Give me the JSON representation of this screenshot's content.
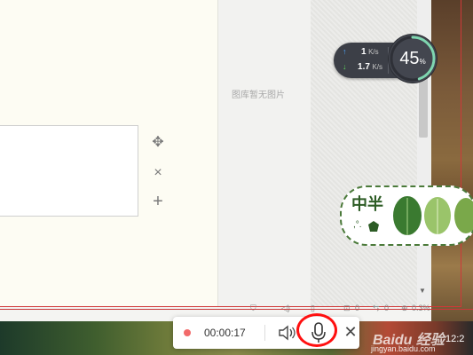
{
  "gallery": {
    "empty_text": "图库暂无图片"
  },
  "image_controls": {
    "move_symbol": "✥",
    "delete_symbol": "×",
    "add_symbol": "+"
  },
  "net_speed": {
    "upload_value": "1",
    "upload_unit": "K/s",
    "download_value": "1.7",
    "download_unit": "K/s",
    "usage_value": "45",
    "usage_unit": "%",
    "usage_fraction": 0.45,
    "up_arrow": "↑",
    "down_arrow": "↓"
  },
  "sticker": {
    "text": "中半",
    "sub": ",°."
  },
  "status_row": {
    "item3": "0",
    "item4": "0",
    "percent": "0.3%"
  },
  "recording": {
    "elapsed": "00:00:17",
    "close_symbol": "✕"
  },
  "watermark": {
    "brand": "Baidu 经验",
    "url": "jingyan.baidu.com"
  },
  "taskbar": {
    "clock": "12:2"
  },
  "colors": {
    "accent_red": "#ff1010",
    "rec_dot": "#f26a6a",
    "widget_bg": "#3c3f47",
    "sticker_green": "#4b7a3a"
  }
}
